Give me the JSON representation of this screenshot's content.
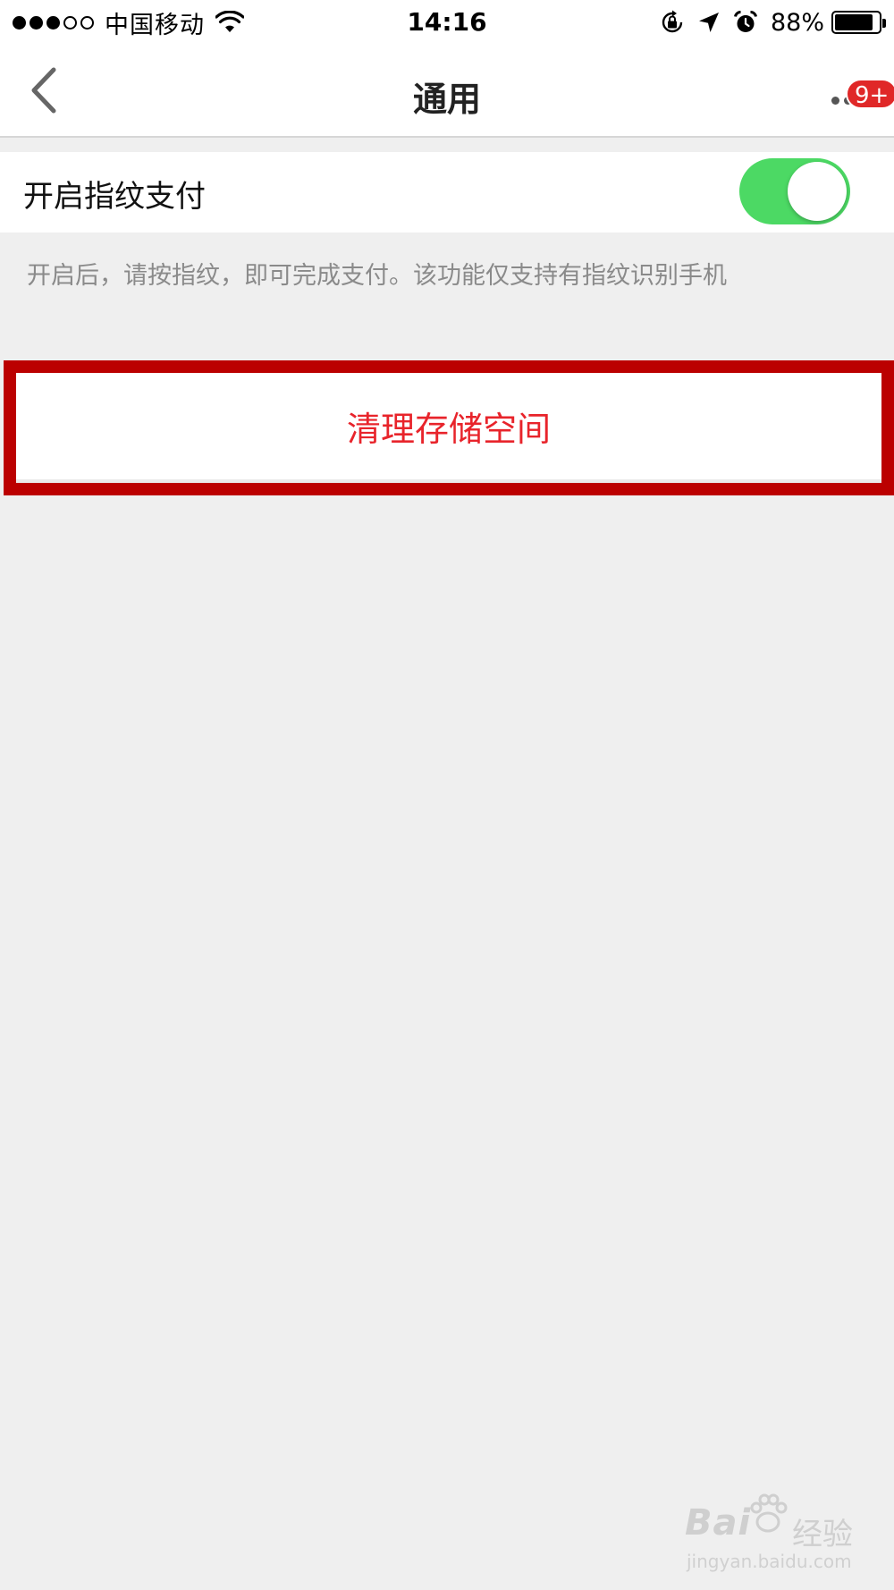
{
  "status_bar": {
    "carrier": "中国移动",
    "time": "14:16",
    "battery_percent": "88%",
    "battery_level": 0.88,
    "signal_bars_filled": 3,
    "signal_bars_total": 5
  },
  "nav": {
    "title": "通用",
    "badge": "9+"
  },
  "settings": {
    "fingerprint_label": "开启指纹支付",
    "fingerprint_enabled": true,
    "fingerprint_hint": "开启后，请按指纹，即可完成支付。该功能仅支持有指纹识别手机",
    "clear_storage_label": "清理存储空间"
  },
  "colors": {
    "toggle_on": "#4cd964",
    "badge": "#e02828",
    "clear_storage_text": "#e8242b",
    "highlight_frame": "#bb0000",
    "background": "#efefef"
  },
  "watermark": {
    "brand": "Bai",
    "brand_suffix": "经验",
    "url": "jingyan.baidu.com"
  }
}
